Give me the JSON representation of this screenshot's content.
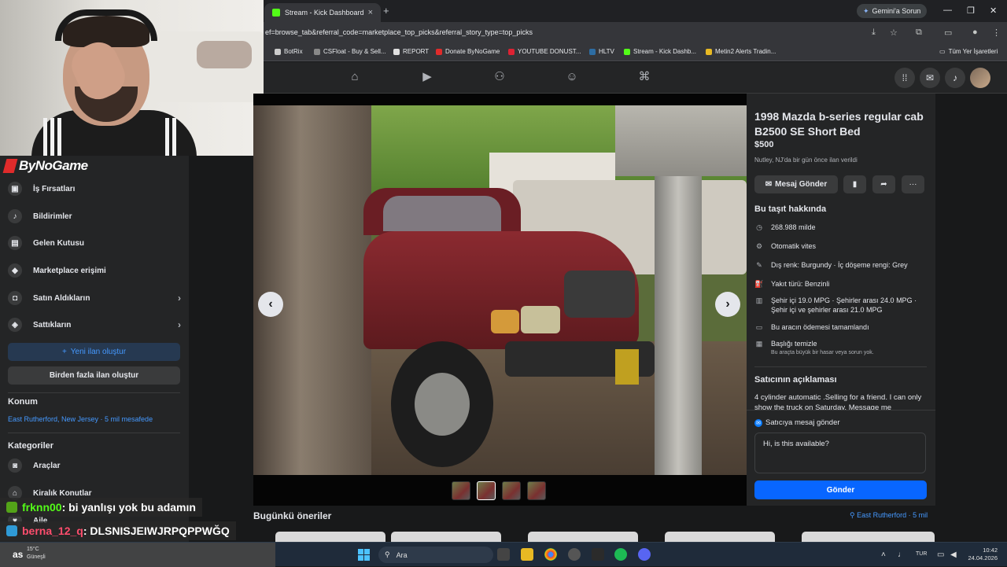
{
  "browser": {
    "tab_kick": "Stream - Kick Dashboard",
    "tab_close": "×",
    "new_tab": "+",
    "gemini": "Gemini'a Sorun",
    "url": "ef=browse_tab&referral_code=marketplace_top_picks&referral_story_type=top_picks",
    "bookmarks": [
      "BotRix",
      "CSFloat - Buy & Sell...",
      "REPORT",
      "Donate ByNoGame",
      "YOUTUBE DONUST...",
      "HLTV",
      "Stream - Kick Dashb...",
      "Metin2 Alerts Tradin..."
    ],
    "all_bookmarks": "Tüm Yer İşaretleri"
  },
  "brand": {
    "name": "ByNoGame"
  },
  "sidebar": {
    "items": [
      {
        "label": "İş Fırsatları",
        "icon": "briefcase-icon",
        "glyph": "▣"
      },
      {
        "label": "Bildirimler",
        "icon": "bell-icon",
        "glyph": "♪"
      },
      {
        "label": "Gelen Kutusu",
        "icon": "inbox-icon",
        "glyph": "▤"
      },
      {
        "label": "Marketplace erişimi",
        "icon": "shield-icon",
        "glyph": "◆"
      },
      {
        "label": "Satın Aldıkların",
        "icon": "bag-icon",
        "glyph": "◘"
      },
      {
        "label": "Sattıkların",
        "icon": "tag-icon",
        "glyph": "◈"
      }
    ],
    "new_listing": "Yeni ilan oluştur",
    "multi_listing": "Birden fazla ilan oluştur",
    "location_heading": "Konum",
    "location_value": "East Rutherford, New Jersey · 5 mil mesafede",
    "categories_heading": "Kategoriler",
    "categories": [
      "Araçlar",
      "Kiralık Konutlar",
      "Aile"
    ]
  },
  "listing": {
    "title": "1998 Mazda b-series regular cab B2500 SE Short Bed",
    "price": "$500",
    "listed": "Nutley, NJ'da bir gün önce ilan verildi",
    "message_btn": "Mesaj Gönder",
    "about_heading": "Bu taşıt hakkında",
    "attributes": [
      {
        "text": "268.988 milde",
        "icon": "odometer-icon",
        "glyph": "◷"
      },
      {
        "text": "Otomatik vites",
        "icon": "gearbox-icon",
        "glyph": "⚙"
      },
      {
        "text": "Dış renk: Burgundy · İç döşeme rengi: Grey",
        "icon": "paint-icon",
        "glyph": "✎"
      },
      {
        "text": "Yakıt türü: Benzinli",
        "icon": "fuel-icon",
        "glyph": "⛽"
      },
      {
        "text": "Şehir içi 19.0 MPG · Şehirler arası 24.0 MPG · Şehir içi ve şehirler arası 21.0 MPG",
        "icon": "fuel-pump-icon",
        "glyph": "▥"
      },
      {
        "text": "Bu aracın ödemesi tamamlandı",
        "icon": "payment-icon",
        "glyph": "▭"
      },
      {
        "text": "Başlığı temizle",
        "sub": "Bu araçta büyük bir hasar veya sorun yok.",
        "icon": "title-icon",
        "glyph": "▦"
      }
    ],
    "seller_desc_heading": "Satıcının açıklaması",
    "seller_desc": "4 cylinder automatic .Selling for a friend. I can only show the truck on Saturday. Message me",
    "seller_msg_label": "Satıcıya mesaj gönder",
    "message_input": "Hi, is this available?",
    "send_btn": "Gönder"
  },
  "suggestions": {
    "title": "Bugünkü öneriler",
    "location": "East Rutherford · 5 mil"
  },
  "chat": [
    {
      "user": "frknn00",
      "msg": ": bi yanlışı yok bu adamın"
    },
    {
      "user": "berna_12_q",
      "msg": ": DLSNISJEIWJRPQPPWĞQ"
    }
  ],
  "taskbar": {
    "temp": "15°C",
    "weather": "Güneşli",
    "search": "Ara",
    "lang": "TUR",
    "time": "10:42",
    "date": "24.04.2026"
  }
}
